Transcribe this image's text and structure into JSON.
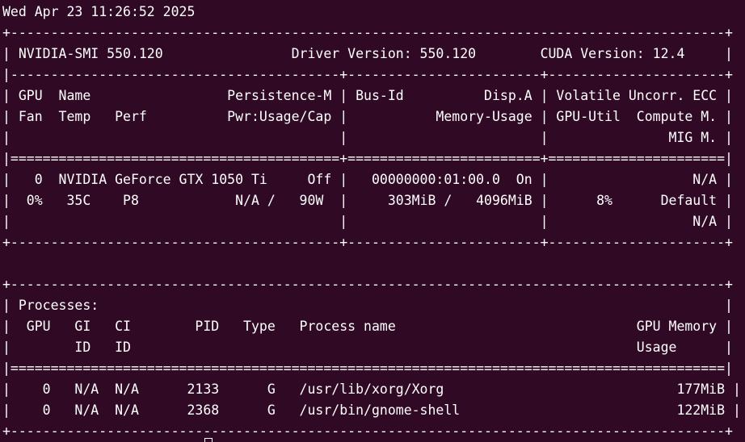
{
  "terminal": {
    "background": "#300a24",
    "foreground": "#ffffff",
    "lines": [
      "Wed Apr 23 11:26:52 2025",
      "+-----------------------------------------------------------------------------------------+",
      "| NVIDIA-SMI 550.120                Driver Version: 550.120        CUDA Version: 12.4     |",
      "|-----------------------------------------+------------------------+----------------------+",
      "| GPU  Name                 Persistence-M | Bus-Id          Disp.A | Volatile Uncorr. ECC |",
      "| Fan  Temp   Perf          Pwr:Usage/Cap |           Memory-Usage | GPU-Util  Compute M. |",
      "|                                         |                        |               MIG M. |",
      "|=========================================+========================+======================|",
      "|   0  NVIDIA GeForce GTX 1050 Ti     Off |   00000000:01:00.0  On |                  N/A |",
      "|  0%   35C    P8            N/A /   90W  |     303MiB /   4096MiB |      8%      Default |",
      "|                                         |                        |                  N/A |",
      "+-----------------------------------------+------------------------+----------------------+",
      "",
      "+-----------------------------------------------------------------------------------------+",
      "| Processes:                                                                              |",
      "|  GPU   GI   CI        PID   Type   Process name                              GPU Memory |",
      "|        ID   ID                                                               Usage      |",
      "|=========================================================================================|",
      "|    0   N/A  N/A      2133      G   /usr/lib/xorg/Xorg                             177MiB |",
      "|    0   N/A  N/A      2368      G   /usr/bin/gnome-shell                           122MiB |",
      "+-----------------------------------------------------------------------------------------+"
    ]
  }
}
